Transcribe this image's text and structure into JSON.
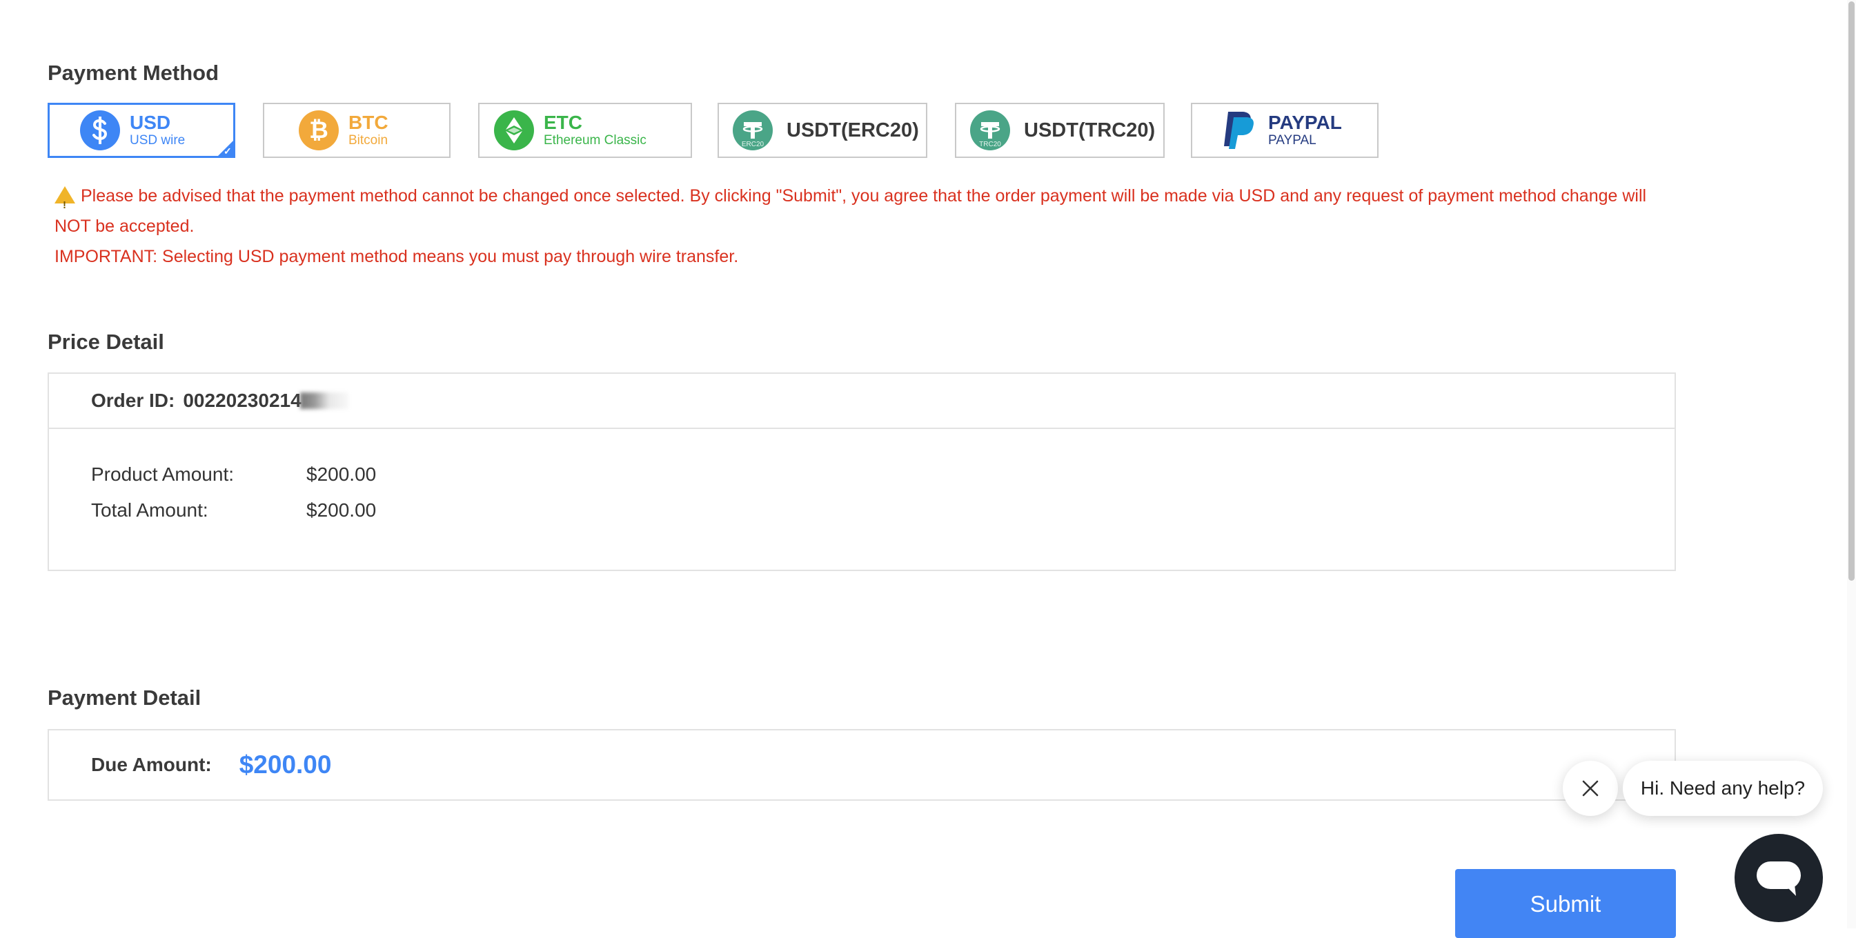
{
  "payment_method": {
    "title": "Payment Method",
    "options": [
      {
        "name": "USD",
        "sub": "USD wire",
        "icon": "dollar-icon",
        "color": "#3e86f5",
        "selected": true
      },
      {
        "name": "BTC",
        "sub": "Bitcoin",
        "icon": "bitcoin-icon",
        "color": "#f2a93b"
      },
      {
        "name": "ETC",
        "sub": "Ethereum Classic",
        "icon": "ethereum-classic-icon",
        "color": "#3ab54a"
      },
      {
        "name": "USDT(ERC20)",
        "badge": "ERC20",
        "icon": "tether-icon",
        "color": "#4aa587"
      },
      {
        "name": "USDT(TRC20)",
        "badge": "TRC20",
        "icon": "tether-icon",
        "color": "#4aa587"
      },
      {
        "name": "PAYPAL",
        "sub": "PAYPAL",
        "icon": "paypal-icon",
        "color": "#253b80"
      }
    ],
    "warning_line1": "Please be advised that the payment method cannot be changed once selected. By clicking \"Submit\", you agree that the order payment will be made via USD and any request of payment method change will NOT be accepted.",
    "warning_line2": "IMPORTANT: Selecting USD payment method means you must pay through wire transfer."
  },
  "price_detail": {
    "title": "Price Detail",
    "order_id_label": "Order ID:",
    "order_id_value": "00220230214",
    "product_amount_label": "Product Amount:",
    "product_amount": "$200.00",
    "total_amount_label": "Total Amount:",
    "total_amount": "$200.00"
  },
  "payment_detail": {
    "title": "Payment Detail",
    "due_label": "Due Amount:",
    "due_amount": "$200.00"
  },
  "submit_label": "Submit",
  "chat": {
    "message": "Hi. Need any help?"
  },
  "colors": {
    "accent": "#3e86f5",
    "warning_text": "#d9311f",
    "submit_bg": "#4285f4"
  }
}
